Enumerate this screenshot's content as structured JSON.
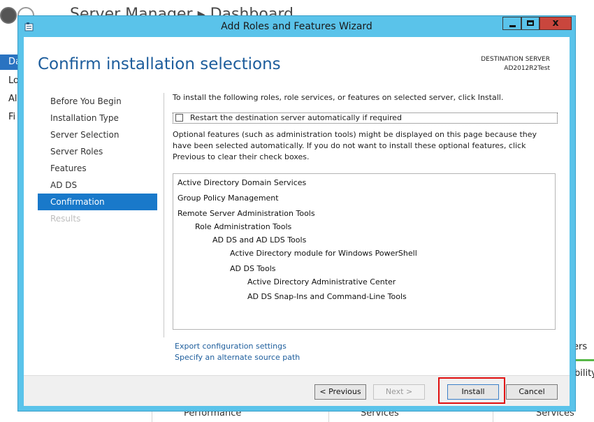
{
  "background": {
    "app_title": "Server Manager ▸ Dashboard",
    "sidebar_items": [
      "Da",
      "Lo",
      "Al",
      "Fi"
    ],
    "right_fragments": [
      "ers",
      "bility"
    ],
    "bottom_labels": [
      "Performance",
      "Services",
      "Services"
    ]
  },
  "window": {
    "title": "Add Roles and Features Wizard",
    "minimize_glyph": "_",
    "close_glyph": "x"
  },
  "page": {
    "title": "Confirm installation selections",
    "destination_label": "DESTINATION SERVER",
    "destination_server": "AD2012R2Test"
  },
  "nav": {
    "items": [
      {
        "label": "Before You Begin",
        "state": "normal"
      },
      {
        "label": "Installation Type",
        "state": "normal"
      },
      {
        "label": "Server Selection",
        "state": "normal"
      },
      {
        "label": "Server Roles",
        "state": "normal"
      },
      {
        "label": "Features",
        "state": "normal"
      },
      {
        "label": "AD DS",
        "state": "normal"
      },
      {
        "label": "Confirmation",
        "state": "selected"
      },
      {
        "label": "Results",
        "state": "disabled"
      }
    ]
  },
  "content": {
    "intro": "To install the following roles, role services, or features on selected server, click Install.",
    "restart_label": "Restart the destination server automatically if required",
    "restart_checked": false,
    "optional_text": "Optional features (such as administration tools) might be displayed on this page because they have been selected automatically. If you do not want to install these optional features, click Previous to clear their check boxes.",
    "selections": [
      {
        "label": "Active Directory Domain Services",
        "level": 0
      },
      {
        "label": "Group Policy Management",
        "level": 0
      },
      {
        "label": "Remote Server Administration Tools",
        "level": 0
      },
      {
        "label": "Role Administration Tools",
        "level": 1
      },
      {
        "label": "AD DS and AD LDS Tools",
        "level": 2
      },
      {
        "label": "Active Directory module for Windows PowerShell",
        "level": 3
      },
      {
        "label": "AD DS Tools",
        "level": 3
      },
      {
        "label": "Active Directory Administrative Center",
        "level": 4
      },
      {
        "label": "AD DS Snap-Ins and Command-Line Tools",
        "level": 4
      }
    ],
    "export_link": "Export configuration settings",
    "alternate_source_link": "Specify an alternate source path"
  },
  "footer": {
    "previous": "< Previous",
    "next": "Next >",
    "install": "Install",
    "cancel": "Cancel"
  },
  "colors": {
    "title_bar": "#5ac3ea",
    "accent": "#1979ca",
    "heading": "#1d5d9c",
    "highlight": "#e01010"
  }
}
